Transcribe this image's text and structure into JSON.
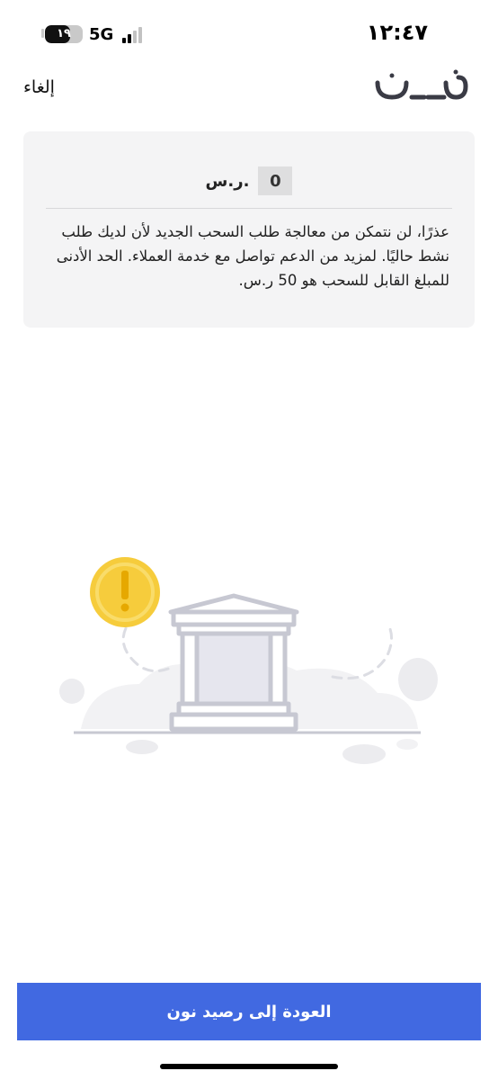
{
  "status_bar": {
    "time": "١٢:٤٧",
    "battery_level": "١٩",
    "battery_fraction": 0.19,
    "network": "5G",
    "signal_bars_active": 2,
    "signal_bars_total": 4
  },
  "header": {
    "cancel_label": "إلغاء",
    "logo_icon": "noon-logo"
  },
  "info_card": {
    "amount": "0",
    "currency": "ر.س.",
    "message": "عذرًا، لن نتمكن من معالجة طلب السحب الجديد لأن لديك طلب نشط حاليًا. لمزيد من الدعم تواصل مع خدمة العملاء. الحد الأدنى للمبلغ القابل للسحب هو 50 ر.س."
  },
  "illustration": {
    "icons": [
      "bank-building-icon",
      "coin-exclamation-icon"
    ]
  },
  "actions": {
    "primary_button_label": "العودة إلى رصيد نون"
  },
  "colors": {
    "primary": "#4169e1",
    "card_background": "#f4f4f5",
    "coin": "#f6cc3c",
    "bank_outline": "#c7c8d2"
  }
}
